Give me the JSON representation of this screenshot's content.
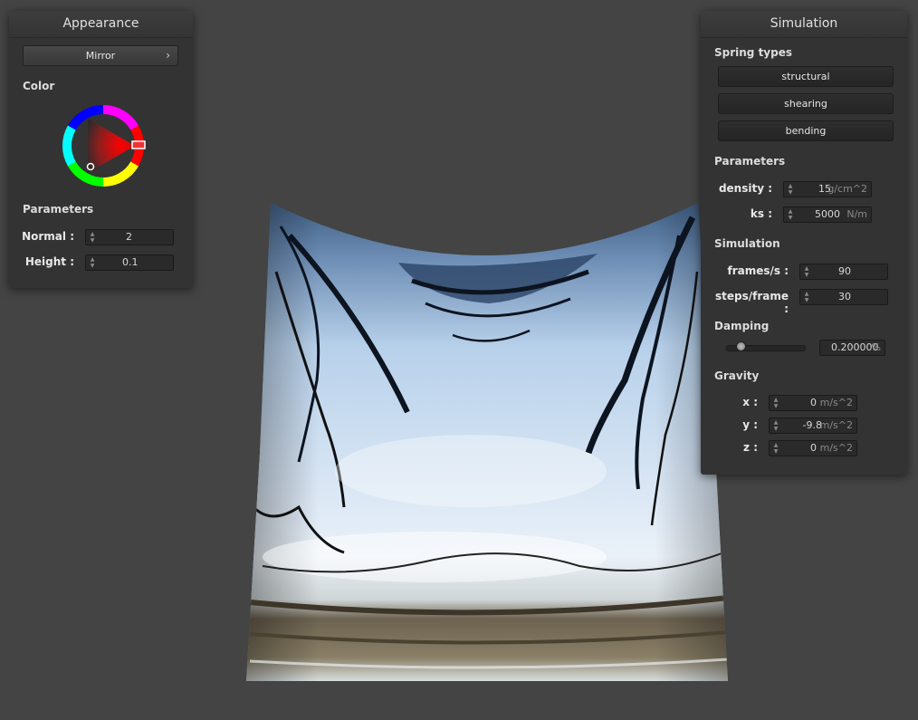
{
  "appearance": {
    "title": "Appearance",
    "shader_selected": "Mirror",
    "color_label": "Color",
    "parameters_label": "Parameters",
    "normal_label": "Normal :",
    "normal_value": "2",
    "height_label": "Height :",
    "height_value": "0.1",
    "selected_color": "#ff0000"
  },
  "simulation": {
    "title": "Simulation",
    "spring_types_label": "Spring types",
    "spring_buttons": [
      "structural",
      "shearing",
      "bending"
    ],
    "parameters_label": "Parameters",
    "density_label": "density :",
    "density_value": "15",
    "density_unit": "g/cm^2",
    "ks_label": "ks :",
    "ks_value": "5000",
    "ks_unit": "N/m",
    "simulation_label": "Simulation",
    "fps_label": "frames/s :",
    "fps_value": "90",
    "steps_label": "steps/frame :",
    "steps_value": "30",
    "damping_label": "Damping",
    "damping_slider_fraction": 0.2,
    "damping_value": "0.200000",
    "damping_unit": "%",
    "gravity_label": "Gravity",
    "gx_label": "x :",
    "gx_value": "0",
    "gy_label": "y :",
    "gy_value": "-9.8",
    "gz_label": "z :",
    "gz_value": "0",
    "gravity_unit": "m/s^2"
  },
  "icons": {
    "popup_chevron": "chevron-right-icon",
    "spinner": "spinner-arrows-icon"
  },
  "glyphs": {
    "chevron": "›",
    "spin_up": "▲",
    "spin_down": "▼"
  },
  "colors": {
    "background": "#444444",
    "panel": "#333333",
    "cloth_sky": "#b9d2ea",
    "cloth_dark": "#3c5878"
  }
}
